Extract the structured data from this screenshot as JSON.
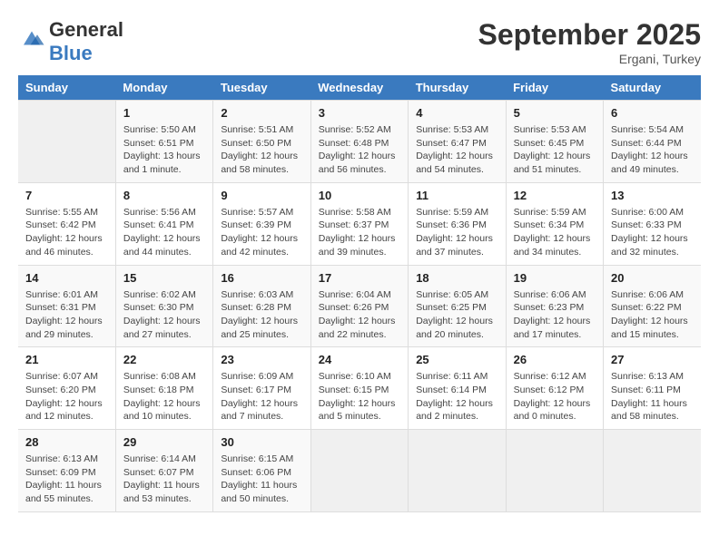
{
  "header": {
    "logo_text_general": "General",
    "logo_text_blue": "Blue",
    "month_title": "September 2025",
    "location": "Ergani, Turkey"
  },
  "weekdays": [
    "Sunday",
    "Monday",
    "Tuesday",
    "Wednesday",
    "Thursday",
    "Friday",
    "Saturday"
  ],
  "weeks": [
    [
      {
        "day": "",
        "sunrise": "",
        "sunset": "",
        "daylight": ""
      },
      {
        "day": "1",
        "sunrise": "Sunrise: 5:50 AM",
        "sunset": "Sunset: 6:51 PM",
        "daylight": "Daylight: 13 hours and 1 minute."
      },
      {
        "day": "2",
        "sunrise": "Sunrise: 5:51 AM",
        "sunset": "Sunset: 6:50 PM",
        "daylight": "Daylight: 12 hours and 58 minutes."
      },
      {
        "day": "3",
        "sunrise": "Sunrise: 5:52 AM",
        "sunset": "Sunset: 6:48 PM",
        "daylight": "Daylight: 12 hours and 56 minutes."
      },
      {
        "day": "4",
        "sunrise": "Sunrise: 5:53 AM",
        "sunset": "Sunset: 6:47 PM",
        "daylight": "Daylight: 12 hours and 54 minutes."
      },
      {
        "day": "5",
        "sunrise": "Sunrise: 5:53 AM",
        "sunset": "Sunset: 6:45 PM",
        "daylight": "Daylight: 12 hours and 51 minutes."
      },
      {
        "day": "6",
        "sunrise": "Sunrise: 5:54 AM",
        "sunset": "Sunset: 6:44 PM",
        "daylight": "Daylight: 12 hours and 49 minutes."
      }
    ],
    [
      {
        "day": "7",
        "sunrise": "Sunrise: 5:55 AM",
        "sunset": "Sunset: 6:42 PM",
        "daylight": "Daylight: 12 hours and 46 minutes."
      },
      {
        "day": "8",
        "sunrise": "Sunrise: 5:56 AM",
        "sunset": "Sunset: 6:41 PM",
        "daylight": "Daylight: 12 hours and 44 minutes."
      },
      {
        "day": "9",
        "sunrise": "Sunrise: 5:57 AM",
        "sunset": "Sunset: 6:39 PM",
        "daylight": "Daylight: 12 hours and 42 minutes."
      },
      {
        "day": "10",
        "sunrise": "Sunrise: 5:58 AM",
        "sunset": "Sunset: 6:37 PM",
        "daylight": "Daylight: 12 hours and 39 minutes."
      },
      {
        "day": "11",
        "sunrise": "Sunrise: 5:59 AM",
        "sunset": "Sunset: 6:36 PM",
        "daylight": "Daylight: 12 hours and 37 minutes."
      },
      {
        "day": "12",
        "sunrise": "Sunrise: 5:59 AM",
        "sunset": "Sunset: 6:34 PM",
        "daylight": "Daylight: 12 hours and 34 minutes."
      },
      {
        "day": "13",
        "sunrise": "Sunrise: 6:00 AM",
        "sunset": "Sunset: 6:33 PM",
        "daylight": "Daylight: 12 hours and 32 minutes."
      }
    ],
    [
      {
        "day": "14",
        "sunrise": "Sunrise: 6:01 AM",
        "sunset": "Sunset: 6:31 PM",
        "daylight": "Daylight: 12 hours and 29 minutes."
      },
      {
        "day": "15",
        "sunrise": "Sunrise: 6:02 AM",
        "sunset": "Sunset: 6:30 PM",
        "daylight": "Daylight: 12 hours and 27 minutes."
      },
      {
        "day": "16",
        "sunrise": "Sunrise: 6:03 AM",
        "sunset": "Sunset: 6:28 PM",
        "daylight": "Daylight: 12 hours and 25 minutes."
      },
      {
        "day": "17",
        "sunrise": "Sunrise: 6:04 AM",
        "sunset": "Sunset: 6:26 PM",
        "daylight": "Daylight: 12 hours and 22 minutes."
      },
      {
        "day": "18",
        "sunrise": "Sunrise: 6:05 AM",
        "sunset": "Sunset: 6:25 PM",
        "daylight": "Daylight: 12 hours and 20 minutes."
      },
      {
        "day": "19",
        "sunrise": "Sunrise: 6:06 AM",
        "sunset": "Sunset: 6:23 PM",
        "daylight": "Daylight: 12 hours and 17 minutes."
      },
      {
        "day": "20",
        "sunrise": "Sunrise: 6:06 AM",
        "sunset": "Sunset: 6:22 PM",
        "daylight": "Daylight: 12 hours and 15 minutes."
      }
    ],
    [
      {
        "day": "21",
        "sunrise": "Sunrise: 6:07 AM",
        "sunset": "Sunset: 6:20 PM",
        "daylight": "Daylight: 12 hours and 12 minutes."
      },
      {
        "day": "22",
        "sunrise": "Sunrise: 6:08 AM",
        "sunset": "Sunset: 6:18 PM",
        "daylight": "Daylight: 12 hours and 10 minutes."
      },
      {
        "day": "23",
        "sunrise": "Sunrise: 6:09 AM",
        "sunset": "Sunset: 6:17 PM",
        "daylight": "Daylight: 12 hours and 7 minutes."
      },
      {
        "day": "24",
        "sunrise": "Sunrise: 6:10 AM",
        "sunset": "Sunset: 6:15 PM",
        "daylight": "Daylight: 12 hours and 5 minutes."
      },
      {
        "day": "25",
        "sunrise": "Sunrise: 6:11 AM",
        "sunset": "Sunset: 6:14 PM",
        "daylight": "Daylight: 12 hours and 2 minutes."
      },
      {
        "day": "26",
        "sunrise": "Sunrise: 6:12 AM",
        "sunset": "Sunset: 6:12 PM",
        "daylight": "Daylight: 12 hours and 0 minutes."
      },
      {
        "day": "27",
        "sunrise": "Sunrise: 6:13 AM",
        "sunset": "Sunset: 6:11 PM",
        "daylight": "Daylight: 11 hours and 58 minutes."
      }
    ],
    [
      {
        "day": "28",
        "sunrise": "Sunrise: 6:13 AM",
        "sunset": "Sunset: 6:09 PM",
        "daylight": "Daylight: 11 hours and 55 minutes."
      },
      {
        "day": "29",
        "sunrise": "Sunrise: 6:14 AM",
        "sunset": "Sunset: 6:07 PM",
        "daylight": "Daylight: 11 hours and 53 minutes."
      },
      {
        "day": "30",
        "sunrise": "Sunrise: 6:15 AM",
        "sunset": "Sunset: 6:06 PM",
        "daylight": "Daylight: 11 hours and 50 minutes."
      },
      {
        "day": "",
        "sunrise": "",
        "sunset": "",
        "daylight": ""
      },
      {
        "day": "",
        "sunrise": "",
        "sunset": "",
        "daylight": ""
      },
      {
        "day": "",
        "sunrise": "",
        "sunset": "",
        "daylight": ""
      },
      {
        "day": "",
        "sunrise": "",
        "sunset": "",
        "daylight": ""
      }
    ]
  ]
}
